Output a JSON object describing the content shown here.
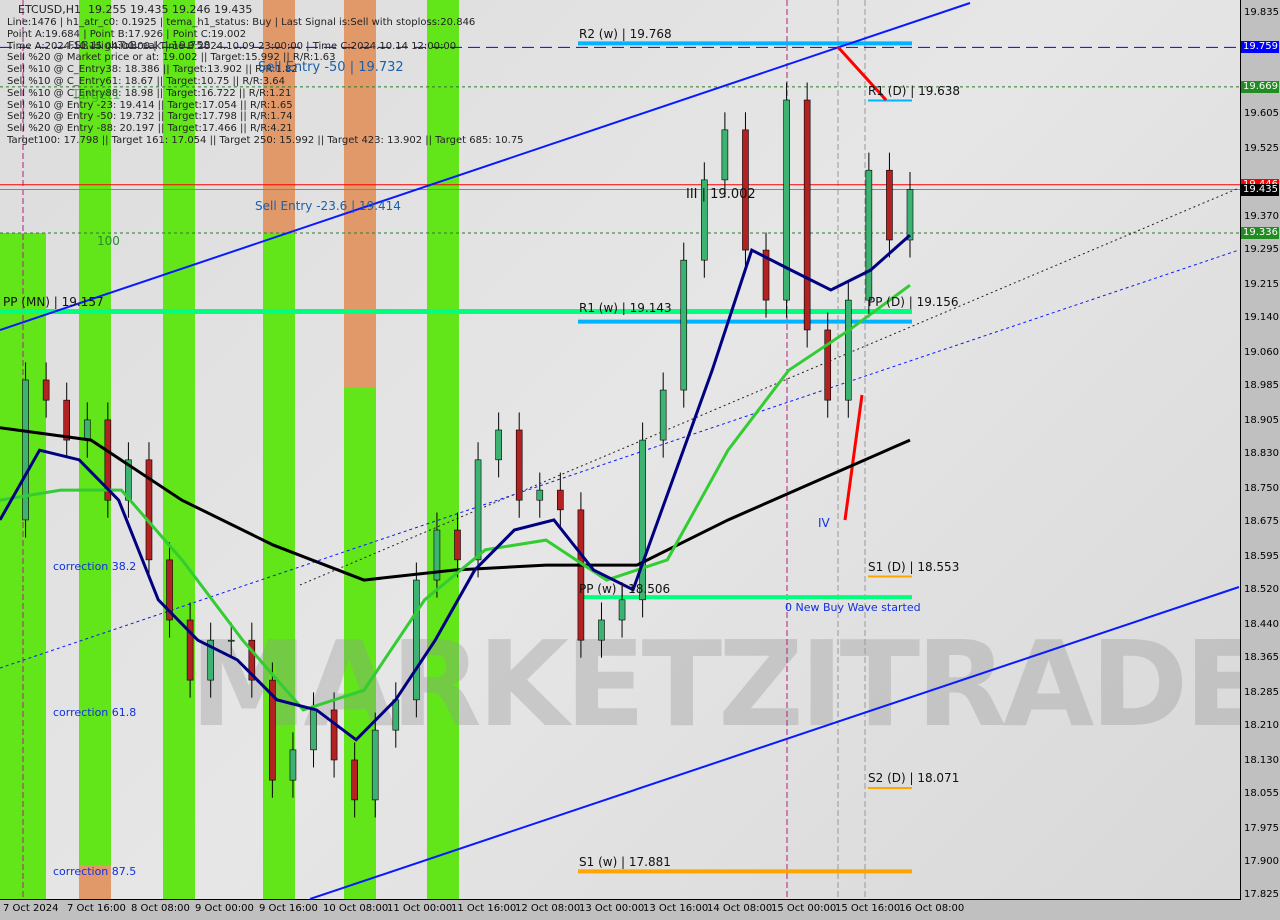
{
  "header": {
    "symbol": "ETCUSD,H1",
    "ohlc": "19.255 19.435 19.246 19.435",
    "info_lines": [
      "Line:1476 | h1_atr_c0: 0.1925 | tema_h1_status: Buy | Last Signal is:Sell with stoploss:20.846",
      "Point A:19.684 | Point B:17.926 | Point C:19.002",
      "Time A:2024.10.15 04:00:00 | Time B:2024.10.09 23:00:00 | Time C:2024.10.14 12:00:00",
      "Sell %20 @ Market price or at: 19.002 || Target:15.992 || R/R:1.63",
      "Sell %10 @ C_Entry38: 18.386 || Target:13.902 || R/R:1.82",
      "Sell %10 @ C_Entry61: 18.67 || Target:10.75 || R/R:3.64",
      "Sell %10 @ C_Entry88: 18.98 || Target:16.722 || R/R:1.21",
      "Sell %10 @ Entry -23: 19.414 || Target:17.054 || R/R:1.65",
      "Sell %20 @ Entry -50: 19.732 || Target:17.798 || R/R:1.74",
      "Sell %20 @ Entry -88: 20.197 || Target:17.466 || R/R:4.21",
      "Target100: 17.798 || Target 161: 17.054 || Target 250: 15.992 || Target 423: 13.902 || Target 685: 10.75"
    ]
  },
  "annotations": {
    "fsb": "FSB-HighToBreak | 19.758",
    "target1": "Target1",
    "sell_entry_50": "Sell Entry -50 | 19.732",
    "sell_entry_236": "Sell Entry -23.6 | 19.414",
    "hundred": "100",
    "wave3": "III | 19.002",
    "wave4": "IV",
    "new_wave": "0 New Buy Wave started",
    "corr382": "correction 38.2",
    "corr618": "correction 61.8",
    "corr875": "correction 87.5",
    "watermark": "MARKETZITRADE"
  },
  "levels": [
    {
      "label": "R2 (w) | 19.768",
      "price": 19.768,
      "color": "#00b4ff"
    },
    {
      "label": "R1 (D) | 19.638",
      "price": 19.638,
      "color": "#00b4ff"
    },
    {
      "label": "PP (MN) | 19.157",
      "price": 19.157,
      "color": "#00ff7f"
    },
    {
      "label": "R1 (w) | 19.143",
      "price": 19.143,
      "color": "#00b4ff"
    },
    {
      "label": "PP (D) | 19.156",
      "price": 19.156,
      "color": "#00ff7f"
    },
    {
      "label": "S1 (D) | 18.553",
      "price": 18.553,
      "color": "#ffa500"
    },
    {
      "label": "PP (w) | 18.506",
      "price": 18.506,
      "color": "#00ff7f"
    },
    {
      "label": "S2 (D) | 18.071",
      "price": 18.071,
      "color": "#ffa500"
    },
    {
      "label": "S1 (w) | 17.881",
      "price": 17.881,
      "color": "#ffa500"
    }
  ],
  "price_tags": [
    {
      "value": "19.759",
      "color": "#0000ff"
    },
    {
      "value": "19.669",
      "color": "#228b22"
    },
    {
      "value": "19.446",
      "color": "#ff0000"
    },
    {
      "value": "19.435",
      "color": "#000000"
    },
    {
      "value": "19.336",
      "color": "#228b22"
    }
  ],
  "chart_data": {
    "type": "candlestick",
    "title": "ETCUSD,H1",
    "ylim": [
      17.825,
      19.835
    ],
    "y_ticks": [
      "19.835",
      "19.759",
      "19.669",
      "19.605",
      "19.525",
      "19.435",
      "19.370",
      "19.295",
      "19.215",
      "19.140",
      "19.060",
      "18.985",
      "18.905",
      "18.830",
      "18.750",
      "18.675",
      "18.595",
      "18.520",
      "18.440",
      "18.365",
      "18.285",
      "18.210",
      "18.130",
      "18.055",
      "17.975",
      "17.900",
      "17.825"
    ],
    "x_ticks": [
      "7 Oct 2024",
      "7 Oct 16:00",
      "8 Oct 08:00",
      "9 Oct 00:00",
      "9 Oct 16:00",
      "10 Oct 08:00",
      "11 Oct 00:00",
      "11 Oct 16:00",
      "12 Oct 08:00",
      "13 Oct 00:00",
      "13 Oct 16:00",
      "14 Oct 08:00",
      "15 Oct 00:00",
      "15 Oct 16:00",
      "16 Oct 08:00"
    ],
    "closes": [
      18.682,
      19.001,
      18.955,
      18.864,
      18.91,
      18.727,
      18.819,
      18.591,
      18.454,
      18.317,
      18.408,
      18.408,
      18.317,
      18.089,
      18.158,
      18.249,
      18.135,
      18.044,
      18.203,
      18.272,
      18.545,
      18.659,
      18.591,
      18.819,
      18.887,
      18.727,
      18.75,
      18.705,
      18.408,
      18.454,
      18.5,
      18.864,
      18.978,
      19.274,
      19.457,
      19.571,
      19.297,
      19.183,
      19.639,
      19.115,
      18.955,
      19.183,
      19.479,
      19.32,
      19.435
    ],
    "series": [
      {
        "color": "#000000",
        "values": [
          18.892,
          18.864,
          18.727,
          18.625,
          18.545,
          18.568,
          18.579,
          18.579,
          18.682,
          18.773,
          18.864
        ]
      },
      {
        "color": "#33cc33",
        "values": [
          18.727,
          18.75,
          18.75,
          18.591,
          18.408,
          18.249,
          18.294,
          18.5,
          18.614,
          18.636,
          18.545,
          18.591,
          18.841,
          19.023,
          19.115,
          19.217
        ]
      },
      {
        "color": "#000080",
        "values": [
          18.682,
          18.841,
          18.819,
          18.727,
          18.5,
          18.408,
          18.363,
          18.272,
          18.249,
          18.181,
          18.272,
          18.408,
          18.568,
          18.659,
          18.682,
          18.568,
          18.523,
          18.773,
          19.023,
          19.297,
          19.251,
          19.206,
          19.251,
          19.331
        ]
      }
    ]
  }
}
